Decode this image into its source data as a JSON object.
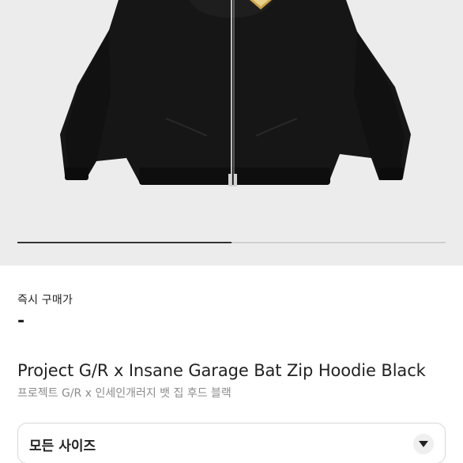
{
  "product_image": {
    "alt": "",
    "carousel_progress": 0.5
  },
  "price": {
    "label": "즉시 구매가",
    "value": "-"
  },
  "product": {
    "title": "Project G/R x Insane Garage Bat Zip Hoodie Black",
    "subtitle": "프로젝트 G/R x 인세인개러지 뱃 집 후드 블랙"
  },
  "size_select": {
    "selected": "모든 사이즈",
    "icon": "chevron-down-icon"
  },
  "colors": {
    "image_bg": "#ececec",
    "hoodie": "#161616",
    "progress_track": "#cfcfcf",
    "progress_fill": "#333333",
    "subtitle": "#8b8b8b"
  }
}
